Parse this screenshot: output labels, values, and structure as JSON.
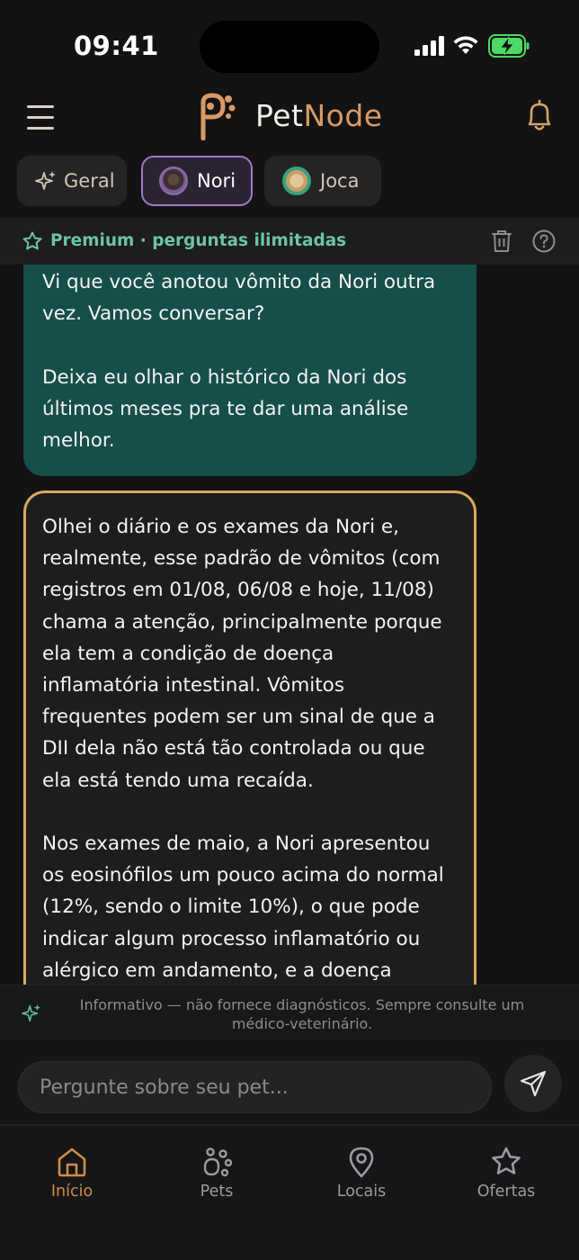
{
  "status_bar": {
    "time": "09:41"
  },
  "header": {
    "logo_pet": "Pet",
    "logo_node": "Node"
  },
  "tabs": [
    {
      "label": "Geral",
      "selected": false
    },
    {
      "label": "Nori",
      "selected": true
    },
    {
      "label": "Joca",
      "selected": false
    }
  ],
  "premium": {
    "label": "Premium · perguntas ilimitadas"
  },
  "messages": [
    {
      "role": "assistant",
      "text": "Vi que você anotou vômito da Nori outra\nvez. Vamos conversar?\n\nDeixa eu olhar o histórico da Nori dos\núltimos meses pra te dar uma análise\nmelhor."
    },
    {
      "role": "assistant",
      "text": "Olhei o diário e os exames da Nori e,\nrealmente, esse padrão de vômitos (com\nregistros em 01/08, 06/08 e hoje, 11/08)\nchama a atenção, principalmente porque\nela tem a condição de doença\ninflamatória intestinal. Vômitos\nfrequentes podem ser um sinal de que a\nDII dela não está tão controlada ou que\nela está tendo uma recaída.\n\nNos exames de maio, a Nori apresentou\nos eosinófilos um pouco acima do normal\n(12%, sendo o limite 10%), o que pode\nindicar algum processo inflamatório ou\nalérgico em andamento, e a doença"
    }
  ],
  "disclaimer": {
    "text": "Informativo — não fornece diagnósticos. Sempre consulte um\nmédico-veterinário."
  },
  "composer": {
    "placeholder": "Pergunte sobre seu pet...",
    "value": ""
  },
  "bottom_nav": [
    {
      "label": "Início",
      "icon": "home-icon",
      "active": true
    },
    {
      "label": "Pets",
      "icon": "paw-icon",
      "active": false
    },
    {
      "label": "Locais",
      "icon": "location-pin-icon",
      "active": false
    },
    {
      "label": "Ofertas",
      "icon": "star-icon",
      "active": false
    }
  ],
  "colors": {
    "background": "#131313",
    "accent_orange": "#d08a4f",
    "premium_green": "#6cc4a8",
    "bubble_teal": "#164e49",
    "bubble_gold_border": "#d7a95c",
    "tab_selected_border": "#a079c9"
  }
}
